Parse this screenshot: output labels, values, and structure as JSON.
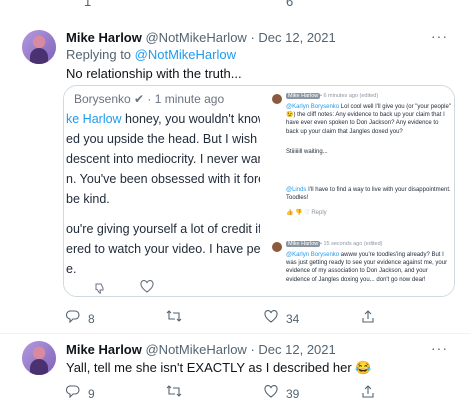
{
  "top_actions": {
    "reply_count": "1",
    "like_count": "6"
  },
  "tweet1": {
    "name": "Mike Harlow",
    "handle": "@NotMikeHarlow",
    "dot": "·",
    "date": "Dec 12, 2021",
    "more": "···",
    "replying_prefix": "Replying to ",
    "replying_handle": "@NotMikeHarlow",
    "text": "No relationship with the truth...",
    "media": {
      "left": {
        "meta": "Borysenko ✔ · 1 minute ago",
        "lines": [
          {
            "hl": "ke Harlow",
            "rest": " honey, you wouldn't know"
          },
          {
            "hl": "",
            "rest": "ed you upside the head. But I wish y"
          },
          {
            "hl": "",
            "rest": "descent into mediocrity. I never wan"
          },
          {
            "hl": "",
            "rest": "n. You've been obsessed with it fore"
          },
          {
            "hl": "",
            "rest": " be kind."
          },
          {
            "hl": "",
            "rest": ""
          },
          {
            "hl": "",
            "rest": "ou're giving yourself a lot of credit if"
          },
          {
            "hl": "",
            "rest": "ered to watch your video. I have peo"
          },
          {
            "hl": "",
            "rest": "e."
          }
        ],
        "dislike_icon": "thumbs-down-icon",
        "heart_icon": "heart-icon"
      },
      "right": {
        "c1_tag": "Mike Harlow",
        "c1_time": "• 6 minutes ago (edited)",
        "c1_mention": "@Karlyn Borysenko",
        "c1_text": " Lol cool well I'll give you (or \"your people\" 😉) the cliff notes: Any evidence to back up your claim that I have ever even spoken to Don Jackson? Any evidence to back up your claim that Jangles doxed you?",
        "c1_text2": "Stiiiiiill waiting...",
        "c2_mention": "@Linds",
        "c2_text": " I'll have to find a way to live with your disappointment. Toodles!",
        "c3_tag": "Mike Harlow",
        "c3_time": "• 15 seconds ago (edited)",
        "c3_mention": "@Karlyn Borysenko",
        "c3_text": " awww you're toodles'ing already? But I was just getting ready to see your evidence against me, your evidence of my association to Don Jackson, and your evidence of Jangles doxing you... don't go now dear!",
        "mini_actions": "👍 👎 ♡ Reply"
      }
    },
    "reply_count": "8",
    "retweet_count": "",
    "like_count": "34"
  },
  "tweet2": {
    "name": "Mike Harlow",
    "handle": "@NotMikeHarlow",
    "dot": "·",
    "date": "Dec 12, 2021",
    "more": "···",
    "text": "Yall, tell me she isn't EXACTLY as I described her 😂",
    "reply_count": "9",
    "retweet_count": "",
    "like_count": "39"
  },
  "icons": {
    "reply": "reply-icon",
    "retweet": "retweet-icon",
    "like": "heart-icon",
    "share": "share-icon"
  }
}
